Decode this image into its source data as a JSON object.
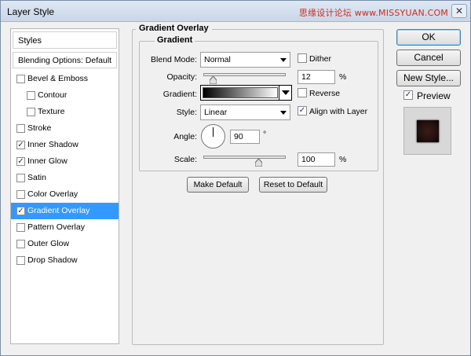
{
  "window": {
    "title": "Layer Style",
    "watermark": "思缘设计论坛 www.MISSYUAN.COM",
    "close_glyph": "✕"
  },
  "sidebar": {
    "header": "Styles",
    "blending": "Blending Options: Default",
    "items": [
      {
        "label": "Bevel & Emboss",
        "checked": false,
        "indent": false
      },
      {
        "label": "Contour",
        "checked": false,
        "indent": true
      },
      {
        "label": "Texture",
        "checked": false,
        "indent": true
      },
      {
        "label": "Stroke",
        "checked": false,
        "indent": false
      },
      {
        "label": "Inner Shadow",
        "checked": true,
        "indent": false
      },
      {
        "label": "Inner Glow",
        "checked": true,
        "indent": false
      },
      {
        "label": "Satin",
        "checked": false,
        "indent": false
      },
      {
        "label": "Color Overlay",
        "checked": false,
        "indent": false
      },
      {
        "label": "Gradient Overlay",
        "checked": true,
        "indent": false,
        "selected": true
      },
      {
        "label": "Pattern Overlay",
        "checked": false,
        "indent": false
      },
      {
        "label": "Outer Glow",
        "checked": false,
        "indent": false
      },
      {
        "label": "Drop Shadow",
        "checked": false,
        "indent": false
      }
    ]
  },
  "panel": {
    "outer_title": "Gradient Overlay",
    "inner_title": "Gradient",
    "blend_mode_label": "Blend Mode:",
    "blend_mode_value": "Normal",
    "dither_label": "Dither",
    "dither_checked": false,
    "opacity_label": "Opacity:",
    "opacity_value": "12",
    "opacity_fraction": 0.12,
    "percent": "%",
    "gradient_label": "Gradient:",
    "reverse_label": "Reverse",
    "reverse_checked": false,
    "style_label": "Style:",
    "style_value": "Linear",
    "align_label": "Align with Layer",
    "align_checked": true,
    "angle_label": "Angle:",
    "angle_value": "90",
    "degree": "°",
    "scale_label": "Scale:",
    "scale_value": "100",
    "scale_fraction": 0.67,
    "make_default": "Make Default",
    "reset_default": "Reset to Default"
  },
  "actions": {
    "ok": "OK",
    "cancel": "Cancel",
    "new_style": "New Style...",
    "preview_label": "Preview",
    "preview_checked": true
  },
  "check_glyph": "✓",
  "colors": {
    "selection": "#3399ff",
    "window_bg": "#f0f0f0"
  }
}
